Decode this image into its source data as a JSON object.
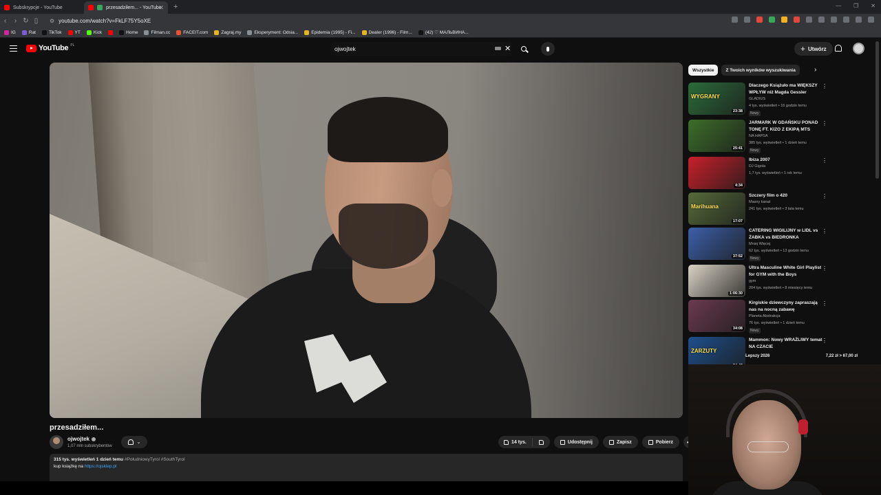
{
  "browser": {
    "tabs": [
      {
        "label": "Subskrypcje - YouTube",
        "active": false
      },
      {
        "label": "przesadziłem... - YouTube",
        "active": true
      }
    ],
    "url": "youtube.com/watch?v=FkLF75Y5oXE",
    "bookmarks": [
      "IG",
      "Rat",
      "TikTok",
      "YT",
      "Kick",
      "",
      "Home",
      "Filman.cc",
      "FACEIT.com",
      "Zagraj.my",
      "Eksperyment: Odsia...",
      "Epidemia (1995) - Fi...",
      "Dealer (1996) - Film...",
      "(42) ♡ МАЛЬВИНА..."
    ]
  },
  "yt": {
    "logo": "YouTube",
    "logo_country": "PL",
    "search_value": "ojwojtek",
    "create_label": "Utwórz"
  },
  "video": {
    "title": "przesadziłem...",
    "channel": "ojwojtek",
    "subscribers": "1,07 mln subskrybentów",
    "likes": "14 tys.",
    "share_label": "Udostępnij",
    "save_label": "Zapisz",
    "download_label": "Pobierz",
    "views_line": "315 tys. wyświetleń  1 dzień temu",
    "tags": "#PołudniowyTyrol #SouthTyrol",
    "desc_prefix": "kup książkę na ",
    "desc_link": "https://ojsklep.pl"
  },
  "sidebar": {
    "chips": [
      "Wszystkie",
      "Z Twoich wyników wyszukiwania"
    ],
    "recs": [
      {
        "title": "Dlaczego Książuło ma WIĘKSZY WPŁYW niż Magda Gessler",
        "channel": "GLADIUS",
        "meta": "4 tys. wyświetleń • 16 godzin temu",
        "badge": "Nowy",
        "duration": "23:38",
        "thumb": "#2b6b3a",
        "thumb_label": "WYGRANY"
      },
      {
        "title": "JARMARK W GDAŃSKU PONAD TONĘ FT. KIZO Z EKIPĄ MTS",
        "channel": "NA HAPSA",
        "meta": "385 tys. wyświetleń • 1 dzień temu",
        "badge": "Nowy",
        "duration": "25:41",
        "thumb": "#3d6e2a",
        "thumb_label": ""
      },
      {
        "title": "Ibiza 2007",
        "channel": "DJ Gigola",
        "meta": "1,7 tys. wyświetleń • 1 rok temu",
        "badge": "",
        "duration": "4:34",
        "thumb": "#c8202a",
        "thumb_label": ""
      },
      {
        "title": "Szczery film o 420",
        "channel": "Masny kanał",
        "meta": "241 tys. wyświetleń • 3 lata temu",
        "badge": "",
        "duration": "17:07",
        "thumb": "#556b3a",
        "thumb_label": "Marihuana"
      },
      {
        "title": "CATERING WIGILIJNY w LIDL vs ŻABKA vs BIEDRONKA",
        "channel": "Mniej Więcej",
        "meta": "62 tys. wyświetleń • 13 godzin temu",
        "badge": "Nowy",
        "duration": "37:52",
        "thumb": "#3c5fa8",
        "thumb_label": ""
      },
      {
        "title": "Ultra Masculine White Girl Playlist for GYM with the Boys",
        "channel": "gym",
        "meta": "204 tys. wyświetleń • 8 miesięcy temu",
        "badge": "",
        "duration": "1:06:30",
        "thumb": "#d9d2c4",
        "thumb_label": ""
      },
      {
        "title": "Kirgiskie dziewczyny zapraszają nas na nocną zabawę",
        "channel": "Planeta Abstrakcja",
        "meta": "76 tys. wyświetleń • 1 dzień temu",
        "badge": "Nowy",
        "duration": "34:08",
        "thumb": "#6b3a4f",
        "thumb_label": ""
      },
      {
        "title": "Mammon: Nowy WRAŻLIWY temat NA CZACIE",
        "channel": "",
        "meta": "",
        "badge": "",
        "duration": "24:43",
        "thumb": "#1e4f8c",
        "thumb_label": "ZARZUTY"
      }
    ]
  },
  "overlay": {
    "price_left": "Lepszy 2026",
    "price_right": "7,22 zł > 67,00 zł"
  }
}
